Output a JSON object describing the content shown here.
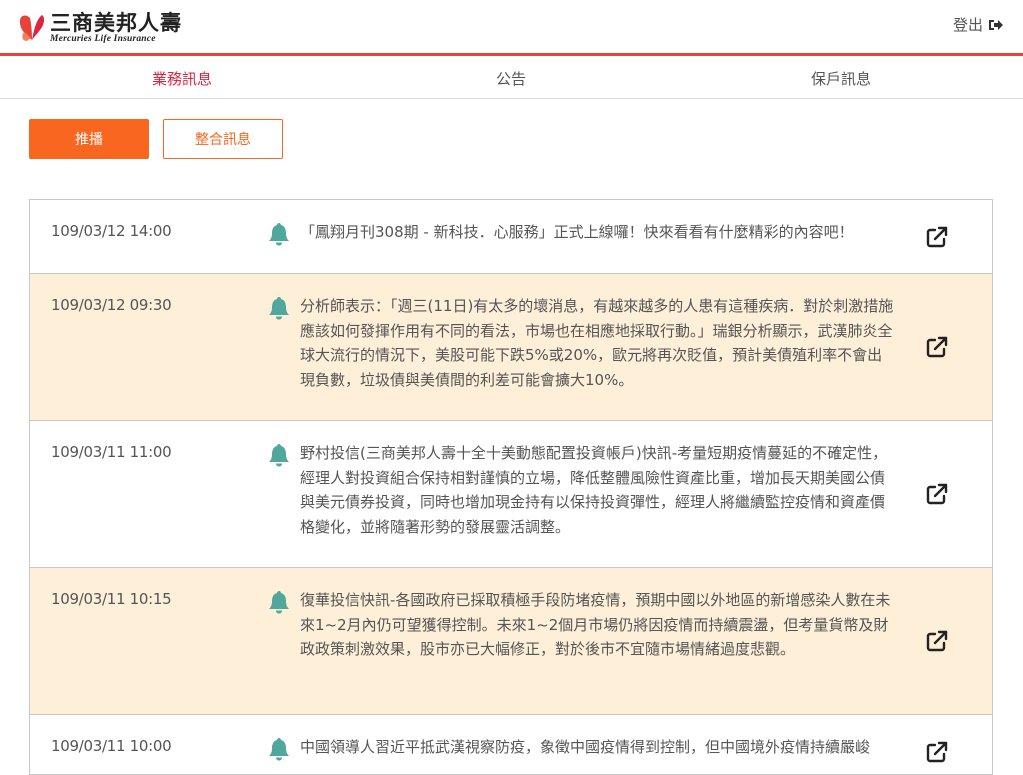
{
  "header": {
    "logo_cn": "三商美邦人壽",
    "logo_en": "Mercuries Life Insurance",
    "logout_label": "登出"
  },
  "tabs": [
    {
      "label": "業務訊息",
      "active": true
    },
    {
      "label": "公告",
      "active": false
    },
    {
      "label": "保戶訊息",
      "active": false
    }
  ],
  "buttons": {
    "broadcast": "推播",
    "integrated": "整合訊息"
  },
  "colors": {
    "accent": "#f86620",
    "active_tab": "#e02440",
    "header_line": "#e8433a",
    "bell": "#4fa89b",
    "highlight_row": "#fdefd8"
  },
  "messages": [
    {
      "date": "109/03/12 14:00",
      "text": "「鳳翔月刊308期 - 新科技．心服務」正式上線囉！快來看看有什麼精彩的內容吧！",
      "highlight": false,
      "icon": "bell-icon",
      "link_icon": "external-link-icon"
    },
    {
      "date": "109/03/12 09:30",
      "text": "分析師表示：「週三(11日)有太多的壞消息，有越來越多的人患有這種疾病．對於刺激措施應該如何發揮作用有不同的看法，市場也在相應地採取行動。」瑞銀分析顯示，武漢肺炎全球大流行的情況下，美股可能下跌5%或20%，歐元將再次貶值，預計美債殖利率不會出現負數，垃圾債與美債間的利差可能會擴大10%。",
      "highlight": true,
      "icon": "bell-icon",
      "link_icon": "external-link-icon"
    },
    {
      "date": "109/03/11 11:00",
      "text": "野村投信(三商美邦人壽十全十美動態配置投資帳戶)快訊-考量短期疫情蔓延的不確定性，經理人對投資組合保持相對謹慎的立場，降低整體風險性資產比重，增加長天期美國公債與美元債券投資，同時也增加現金持有以保持投資彈性，經理人將繼續監控疫情和資產價格變化，並將隨著形勢的發展靈活調整。",
      "highlight": false,
      "icon": "bell-icon",
      "link_icon": "external-link-icon"
    },
    {
      "date": "109/03/11 10:15",
      "text": "復華投信快訊-各國政府已採取積極手段防堵疫情，預期中國以外地區的新增感染人數在未來1~2月內仍可望獲得控制。未來1~2個月市場仍將因疫情而持續震盪，但考量貨幣及財政政策刺激效果，股市亦已大幅修正，對於後市不宜隨市場情緒過度悲觀。",
      "highlight": true,
      "icon": "bell-icon",
      "link_icon": "external-link-icon"
    },
    {
      "date": "109/03/11 10:00",
      "text": "中國領導人習近平抵武漢視察防疫，象徵中國疫情得到控制，但中國境外疫情持續嚴峻",
      "highlight": false,
      "icon": "bell-icon",
      "link_icon": "external-link-icon"
    }
  ]
}
